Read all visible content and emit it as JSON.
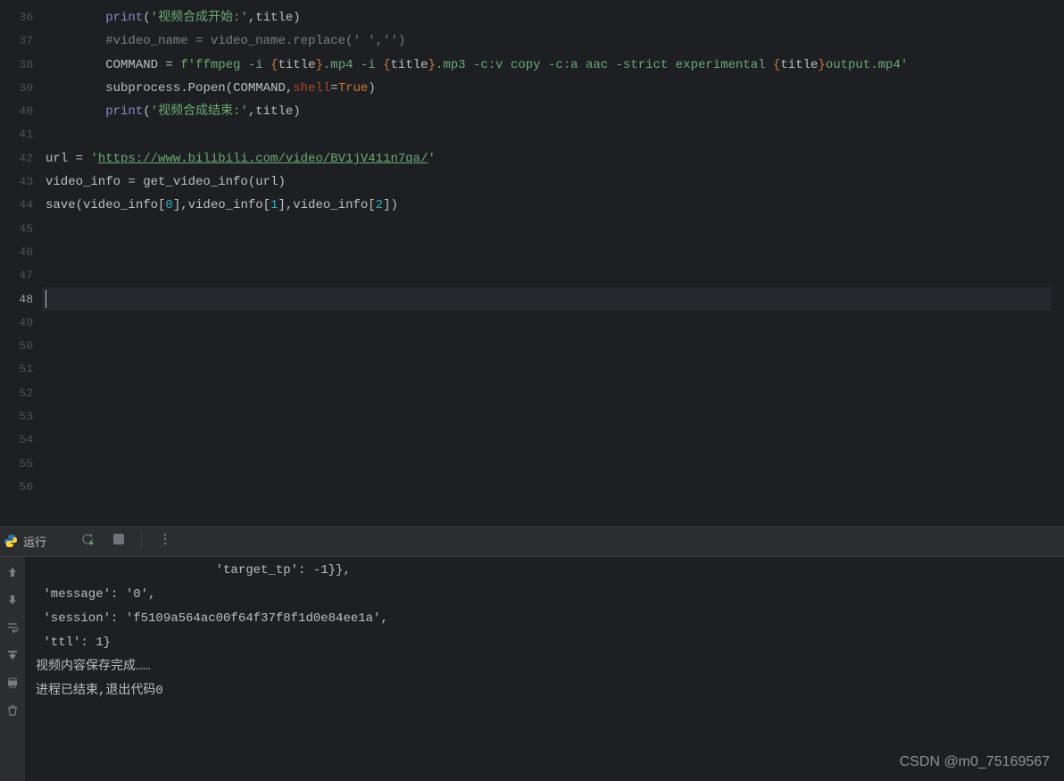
{
  "gutter": {
    "start": 36,
    "end": 56,
    "current": 48
  },
  "code": {
    "line36": {
      "indent": "        ",
      "print": "print",
      "lparen": "(",
      "str": "'视频合成开始:'",
      "comma": ",",
      "var": "title",
      "rparen": ")"
    },
    "line37": {
      "indent": "        ",
      "comment": "#video_name = video_name.replace(' ','')"
    },
    "line38": {
      "indent": "        ",
      "var": "COMMAND = ",
      "fprefix": "f",
      "s1": "'ffmpeg -i ",
      "lb1": "{",
      "v1": "title",
      "rb1": "}",
      "s2": ".mp4 -i ",
      "lb2": "{",
      "v2": "title",
      "rb2": "}",
      "s3": ".mp3 -c:v copy -c:a aac -strict experimental ",
      "lb3": "{",
      "v3": "title",
      "rb3": "}",
      "s4": "output.mp4'"
    },
    "line39": {
      "indent": "        ",
      "t1": "subprocess",
      "dot": ".",
      "t2": "Popen",
      "lparen": "(",
      "arg1": "COMMAND",
      "comma": ",",
      "kw": "shell",
      "eq": "=",
      "true": "True",
      "rparen": ")"
    },
    "line40": {
      "indent": "        ",
      "print": "print",
      "lparen": "(",
      "str": "'视频合成结束:'",
      "comma": ",",
      "var": "title",
      "rparen": ")"
    },
    "line42": {
      "t1": "url = ",
      "q1": "'",
      "link": "https://www.bilibili.com/video/BV1jV411n7qa/",
      "q2": "'"
    },
    "line43": {
      "t1": "video_info = get_video_info(url)"
    },
    "line44": {
      "t1": "save(video_info[",
      "n0": "0",
      "t2": "],video_info[",
      "n1": "1",
      "t3": "],video_info[",
      "n2": "2",
      "t4": "])"
    }
  },
  "terminal": {
    "run_label": "运行",
    "output": {
      "l1": "                        'target_tp': -1}},",
      "l2": " 'message': '0',",
      "l3": " 'session': 'f5109a564ac00f64f37f8f1d0e84ee1a',",
      "l4": " 'ttl': 1}",
      "l5": "视频内容保存完成……",
      "l6": "",
      "l7": "进程已结束,退出代码0"
    }
  },
  "watermark": "CSDN @m0_75169567"
}
